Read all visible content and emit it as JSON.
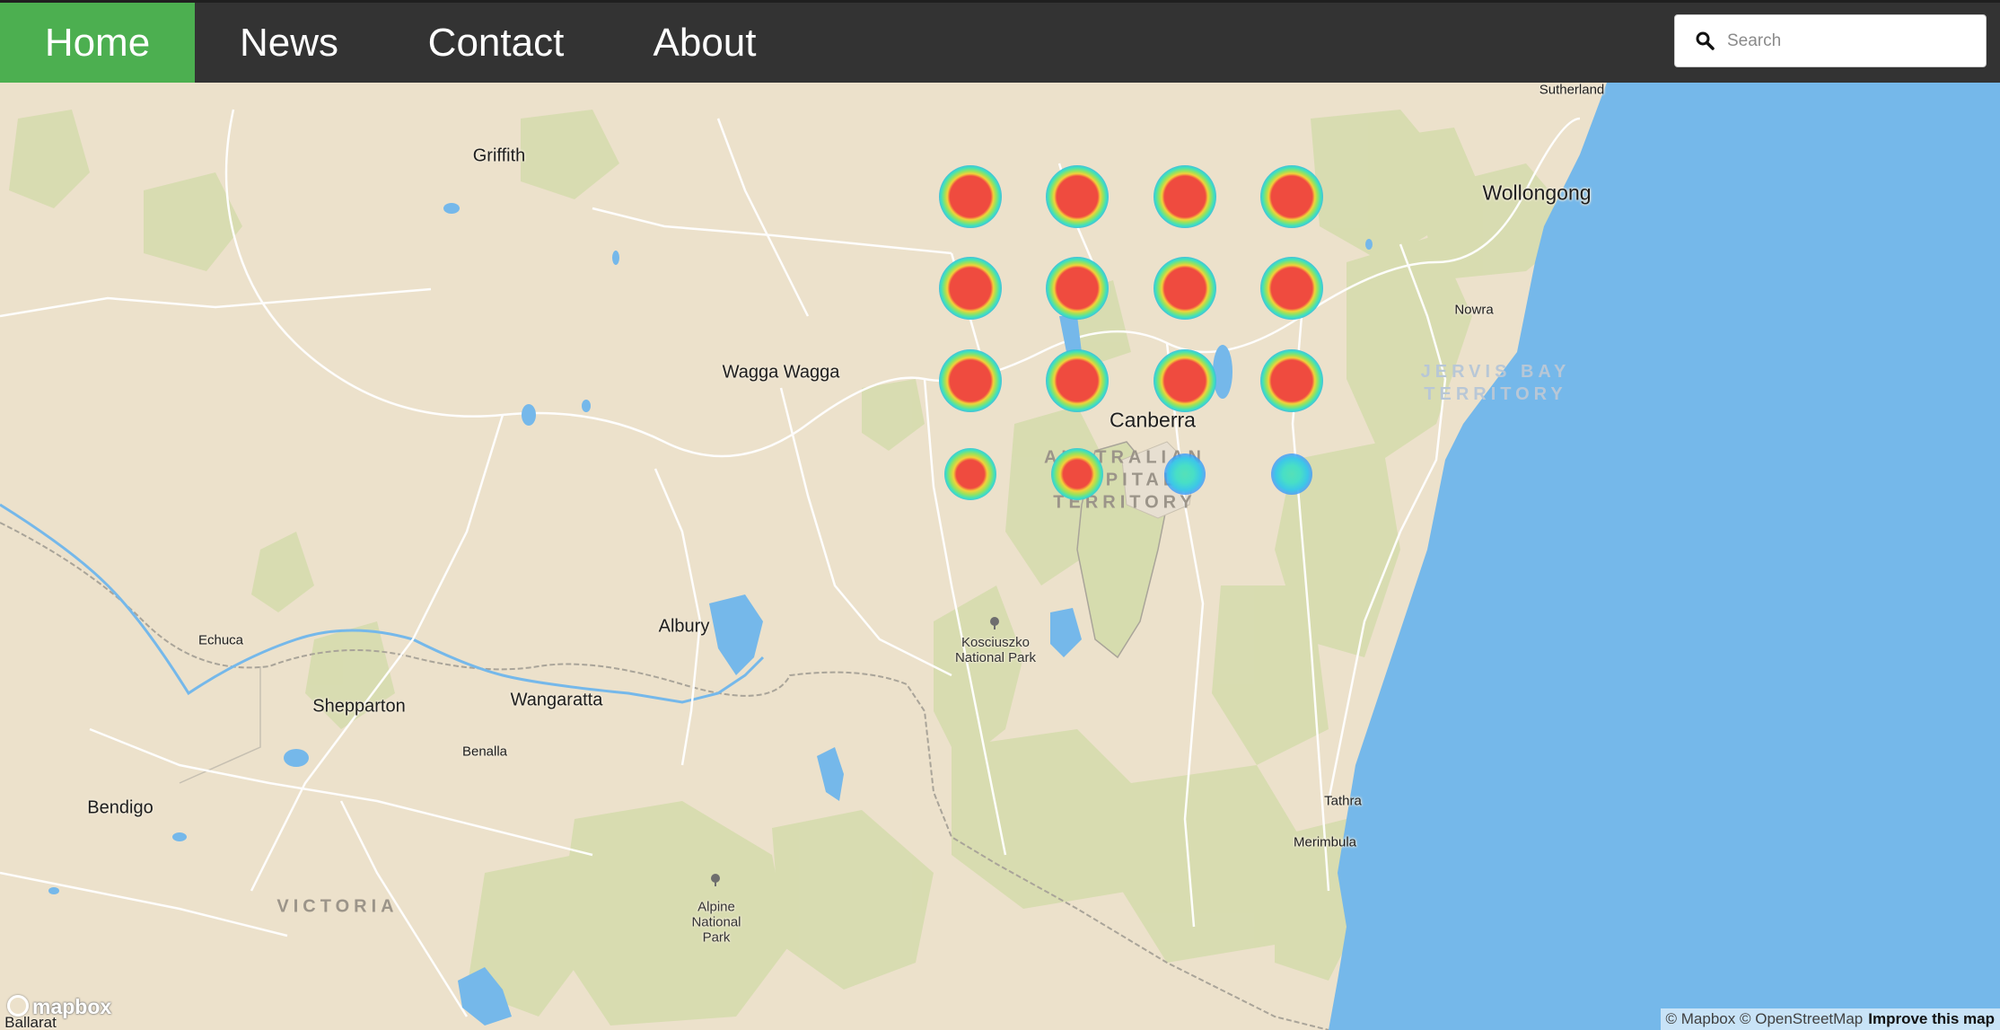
{
  "navbar": {
    "items": [
      {
        "label": "Home",
        "active": true
      },
      {
        "label": "News",
        "active": false
      },
      {
        "label": "Contact",
        "active": false
      },
      {
        "label": "About",
        "active": false
      }
    ],
    "search": {
      "placeholder": "Search",
      "value": ""
    },
    "colors": {
      "bar": "#333333",
      "active": "#4caf50"
    }
  },
  "map": {
    "colors": {
      "land": "#ece1cb",
      "water": "#75b8ea",
      "park": "#d8dcb0"
    },
    "labels": {
      "sutherland": "Sutherland",
      "wollongong": "Wollongong",
      "griffith": "Griffith",
      "nowra": "Nowra",
      "jervis_bay": "JERVIS BAY\nTERRITORY",
      "wagga_wagga": "Wagga Wagga",
      "canberra": "Canberra",
      "act": "AUSTRALIAN\nCAPITAL\nTERRITORY",
      "echuca": "Echuca",
      "albury": "Albury",
      "kosciuszko": "Kosciuszko\nNational Park",
      "shepparton": "Shepparton",
      "wangaratta": "Wangaratta",
      "benalla": "Benalla",
      "bendigo": "Bendigo",
      "tathra": "Tathra",
      "merimbula": "Merimbula",
      "alpine": "Alpine\nNational\nPark",
      "victoria": "VICTORIA",
      "ballarat": "Ballarat"
    },
    "heatmap_intensities": [
      "strong",
      "strong",
      "strong",
      "strong",
      "strong",
      "strong",
      "strong",
      "strong",
      "strong",
      "strong",
      "strong",
      "strong",
      "medium",
      "medium",
      "weak",
      "weak"
    ],
    "logo": "mapbox",
    "attribution": {
      "text": "© Mapbox © OpenStreetMap",
      "link": "Improve this map"
    }
  }
}
